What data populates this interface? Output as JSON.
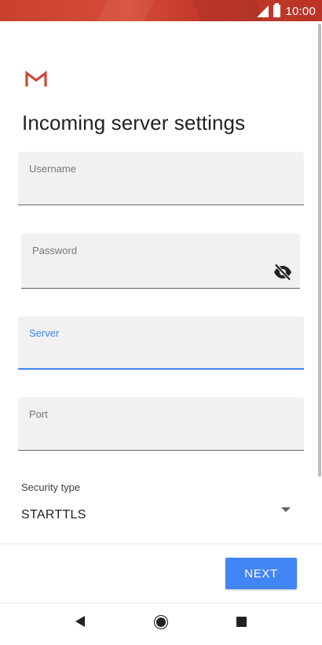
{
  "status_bar": {
    "time": "10:00",
    "icons": [
      "signal-icon",
      "battery-icon"
    ]
  },
  "header": {
    "app_icon": "gmail-icon",
    "title": "Incoming server settings"
  },
  "form": {
    "username": {
      "label": "Username",
      "value": ""
    },
    "password": {
      "label": "Password",
      "value": "",
      "toggle_icon": "eye-off-icon"
    },
    "server": {
      "label": "Server",
      "value": "",
      "focused": true
    },
    "port": {
      "label": "Port",
      "value": ""
    },
    "security": {
      "label": "Security type",
      "value": "STARTTLS"
    }
  },
  "actions": {
    "next_label": "NEXT"
  },
  "nav_bar": {
    "icons": [
      "back-icon",
      "home-icon",
      "recents-icon"
    ]
  },
  "colors": {
    "accent": "#4285f4",
    "status_bar": "#d14836",
    "field_background": "#f1f1f1"
  }
}
